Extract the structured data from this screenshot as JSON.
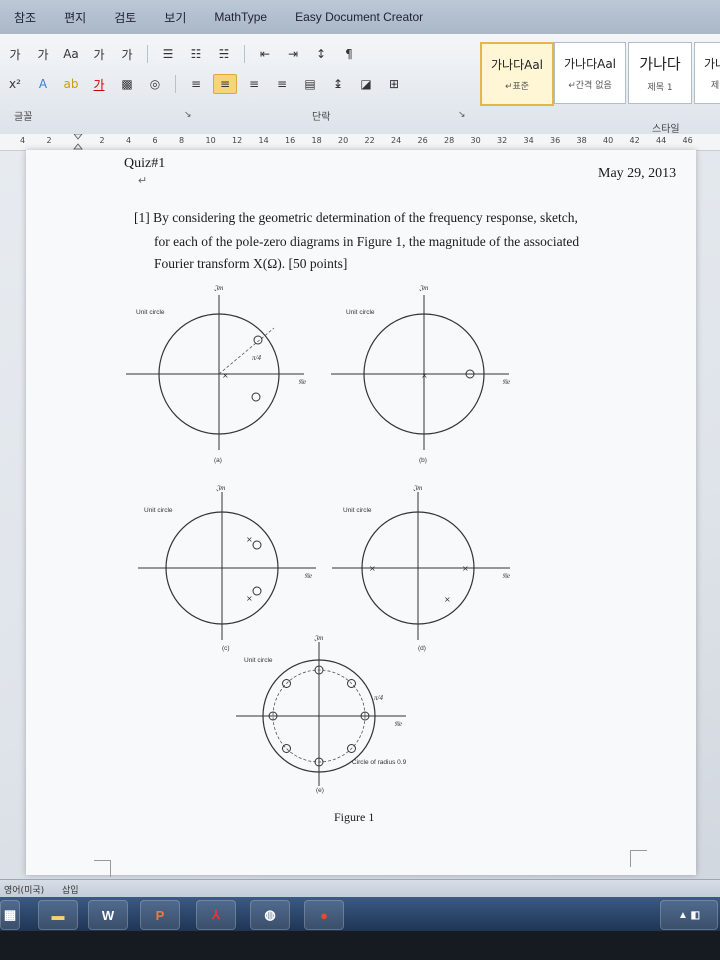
{
  "menu": {
    "tabs": [
      "참조",
      "편지",
      "검토",
      "보기",
      "MathType",
      "Easy Document Creator"
    ]
  },
  "ribbon": {
    "font_group": {
      "label": "글꼴",
      "buttons": [
        "가",
        "가",
        "Aa",
        "가",
        "가",
        "x²",
        "가"
      ]
    },
    "paragraph_group": {
      "label": "단락"
    },
    "styles_group": {
      "label": "스타일",
      "styles": [
        {
          "sample": "가나다Aal",
          "name": "↵표준"
        },
        {
          "sample": "가나다Aal",
          "name": "↵간격 없음"
        },
        {
          "sample": "가나다",
          "name": "제목 1"
        },
        {
          "sample": "가나",
          "name": "제"
        }
      ]
    }
  },
  "ruler": {
    "numbers": [
      "4",
      "2",
      "",
      "2",
      "4",
      "6",
      "8",
      "10",
      "12",
      "14",
      "16",
      "18",
      "20",
      "22",
      "24",
      "26",
      "28",
      "30",
      "32",
      "34",
      "36",
      "38",
      "40",
      "42",
      "44",
      "46"
    ]
  },
  "document": {
    "quiz_title": "Quiz#1",
    "date": "May 29, 2013",
    "question_lines": [
      "[1] By considering the geometric determination of the frequency response, sketch,",
      "for each of the pole-zero diagrams in Figure 1, the magnitude of the associated",
      "Fourier transform X(Ω). [50 points]"
    ],
    "figure_caption": "Figure 1"
  },
  "figures": {
    "unit_circle_label": "Unit circle",
    "im_label": "𝔍m",
    "re_label": "𝔑e",
    "pi_label": "π/4",
    "circle_radius_label": "Circle of radius 0.9",
    "subfig_labels": [
      "(a)",
      "(b)",
      "(c)",
      "(d)",
      "(e)"
    ]
  },
  "statusbar": {
    "language": "영어(미국)",
    "mode": "삽입"
  },
  "taskbar": {
    "apps": [
      "folder",
      "W",
      "P",
      "pdf",
      "globe",
      "app"
    ]
  },
  "colors": {
    "ribbon_active": "#f6d57a",
    "taskbar": "#2a4670",
    "page": "#f8f9fb"
  }
}
